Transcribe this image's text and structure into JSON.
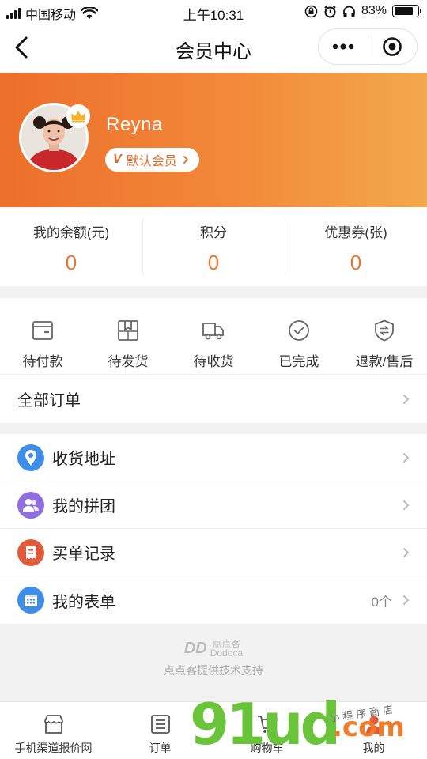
{
  "status_bar": {
    "carrier": "中国移动",
    "time": "上午10:31",
    "battery_percent": "83%",
    "battery_level": 0.83
  },
  "nav": {
    "title": "会员中心",
    "back_icon": "chevron-left-icon",
    "more_icon": "more-dots-icon",
    "close_icon": "target-circle-icon"
  },
  "profile": {
    "name": "Reyna",
    "member_level": "默认会员",
    "member_prefix": "V",
    "crown_icon": "crown-icon"
  },
  "stats": [
    {
      "label": "我的余额(元)",
      "value": "0"
    },
    {
      "label": "积分",
      "value": "0"
    },
    {
      "label": "优惠券(张)",
      "value": "0"
    }
  ],
  "orders": {
    "items": [
      {
        "label": "待付款",
        "icon": "wallet-icon"
      },
      {
        "label": "待发货",
        "icon": "package-icon"
      },
      {
        "label": "待收货",
        "icon": "truck-icon"
      },
      {
        "label": "已完成",
        "icon": "check-circle-icon"
      },
      {
        "label": "退款/售后",
        "icon": "refund-shield-icon"
      }
    ],
    "all_orders_label": "全部订单"
  },
  "menu": [
    {
      "label": "收货地址",
      "icon": "location-pin-icon",
      "color": "#3d8ee8",
      "count": ""
    },
    {
      "label": "我的拼团",
      "icon": "group-users-icon",
      "color": "#8f6fe0",
      "count": ""
    },
    {
      "label": "买单记录",
      "icon": "receipt-icon",
      "color": "#e05a3c",
      "count": ""
    },
    {
      "label": "我的表单",
      "icon": "calendar-grid-icon",
      "color": "#3d8ee8",
      "count": "0个"
    }
  ],
  "footer": {
    "brand_mark": "DD",
    "brand_name": "点点客",
    "brand_sub": "Dodoca",
    "support_text": "点点客提供技术支持"
  },
  "tab_bar": [
    {
      "label": "手机渠道报价网",
      "icon": "store-icon"
    },
    {
      "label": "订单",
      "icon": "order-list-icon"
    },
    {
      "label": "购物车",
      "icon": "cart-icon"
    },
    {
      "label": "我的",
      "icon": "user-icon"
    }
  ],
  "watermark": {
    "number": "91",
    "suffix": "ud",
    "domain": ".com",
    "chinese": "小程序商店"
  },
  "colors": {
    "accent_orange": "#e8772e",
    "banner_start": "#ec6f2a",
    "banner_end": "#f2a94a"
  }
}
